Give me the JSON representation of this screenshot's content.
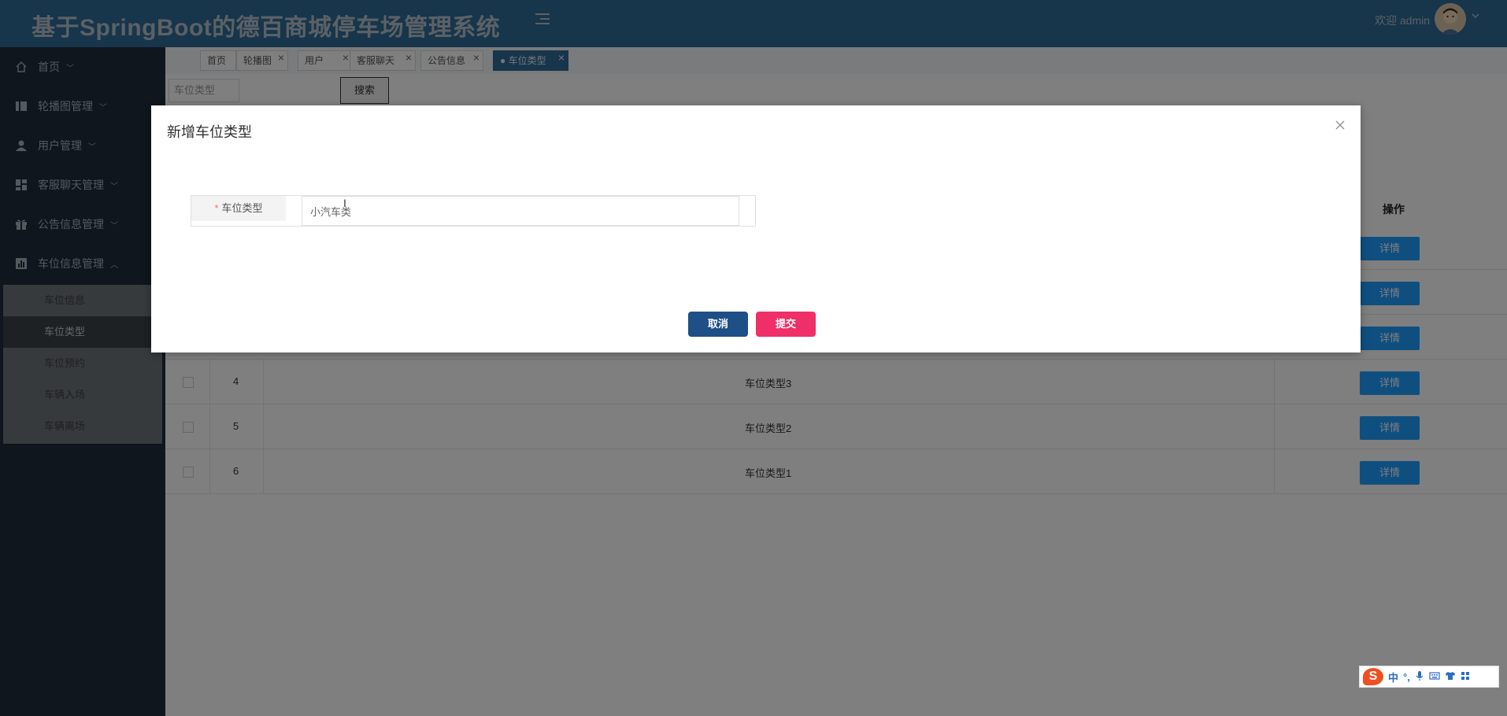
{
  "header": {
    "title": "基于SpringBoot的德百商城停车场管理系统",
    "welcome": "欢迎 admin"
  },
  "sidebar": {
    "items": [
      {
        "label": "首页",
        "icon": "home-icon"
      },
      {
        "label": "轮播图管理",
        "icon": "carousel-icon"
      },
      {
        "label": "用户管理",
        "icon": "user-icon"
      },
      {
        "label": "客服聊天管理",
        "icon": "dashboard-icon"
      },
      {
        "label": "公告信息管理",
        "icon": "gift-icon"
      },
      {
        "label": "车位信息管理",
        "icon": "bar-chart-icon"
      }
    ],
    "submenu": [
      "车位信息",
      "车位类型",
      "车位预约",
      "车辆入场",
      "车辆离场"
    ],
    "active_sub": "车位类型"
  },
  "tabs": [
    {
      "label": "首页",
      "closable": false
    },
    {
      "label": "轮播图",
      "closable": true
    },
    {
      "label": "用户",
      "closable": true
    },
    {
      "label": "客服聊天",
      "closable": true
    },
    {
      "label": "公告信息",
      "closable": true
    },
    {
      "label": "● 车位类型",
      "closable": true,
      "active": true
    }
  ],
  "search": {
    "placeholder": "车位类型",
    "button": "搜索"
  },
  "table": {
    "op_header": "操作",
    "detail_button": "详情",
    "rows": [
      {
        "index": "",
        "name": ""
      },
      {
        "index": "",
        "name": ""
      },
      {
        "index": "",
        "name": ""
      },
      {
        "index": "4",
        "name": "车位类型3"
      },
      {
        "index": "5",
        "name": "车位类型2"
      },
      {
        "index": "6",
        "name": "车位类型1"
      }
    ]
  },
  "modal": {
    "title": "新增车位类型",
    "field_label": "车位类型",
    "field_value": "小汽车类",
    "cancel": "取消",
    "submit": "提交"
  },
  "ime": {
    "logo": "S",
    "mode": "中",
    "punct": "°,"
  },
  "colors": {
    "header_bg": "#2f6a96",
    "sidebar_bg": "#1f2d3b",
    "detail_btn": "#1e9fff",
    "cancel_btn": "#1e4f86",
    "submit_btn": "#ef2f67"
  }
}
